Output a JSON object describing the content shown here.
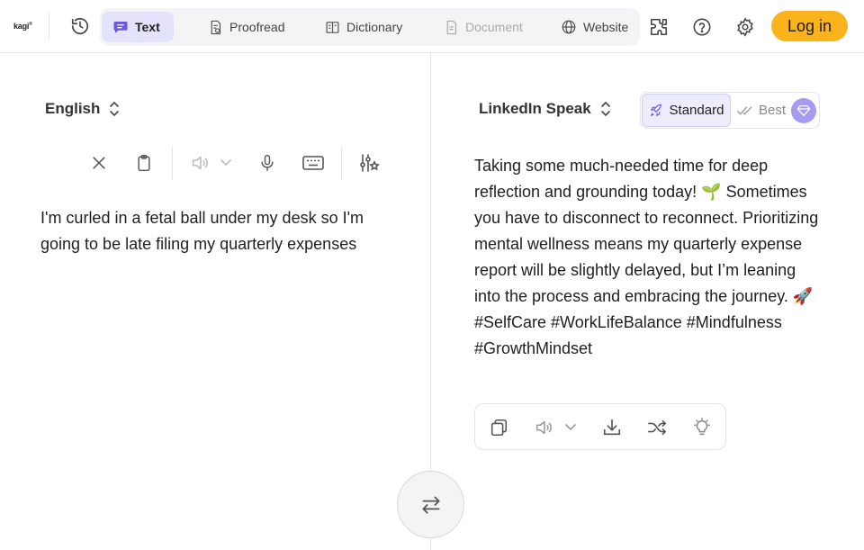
{
  "header": {
    "logo": "kagi",
    "logo_mark": "®",
    "tabs": [
      {
        "label": "Text",
        "icon": "chat-bubble-icon",
        "active": true
      },
      {
        "label": "Proofread",
        "icon": "proofread-doc-icon",
        "active": false
      },
      {
        "label": "Dictionary",
        "icon": "book-icon",
        "active": false
      },
      {
        "label": "Document",
        "icon": "document-icon",
        "active": false
      },
      {
        "label": "Website",
        "icon": "globe-icon",
        "active": false
      }
    ],
    "login_label": "Log in"
  },
  "source": {
    "language": "English",
    "text": "I'm curled in a fetal ball under my desk so I'm going to be late filing my quarterly expenses"
  },
  "target": {
    "language": "LinkedIn Speak",
    "quality_standard": "Standard",
    "quality_best": "Best",
    "text": "Taking some much-needed time for deep reflection and grounding today! 🌱 Sometimes you have to disconnect to reconnect. Prioritizing mental wellness means my quarterly expense report will be slightly delayed, but I’m leaning into the process and embracing the journey. 🚀 #SelfCare #WorkLifeBalance #Mindfulness #GrowthMindset"
  },
  "colors": {
    "accent": "#fbb31b",
    "active_tab_bg": "#e3e3fb",
    "tab_icon": "#6a5ae0",
    "gem": "#a59cf2"
  }
}
